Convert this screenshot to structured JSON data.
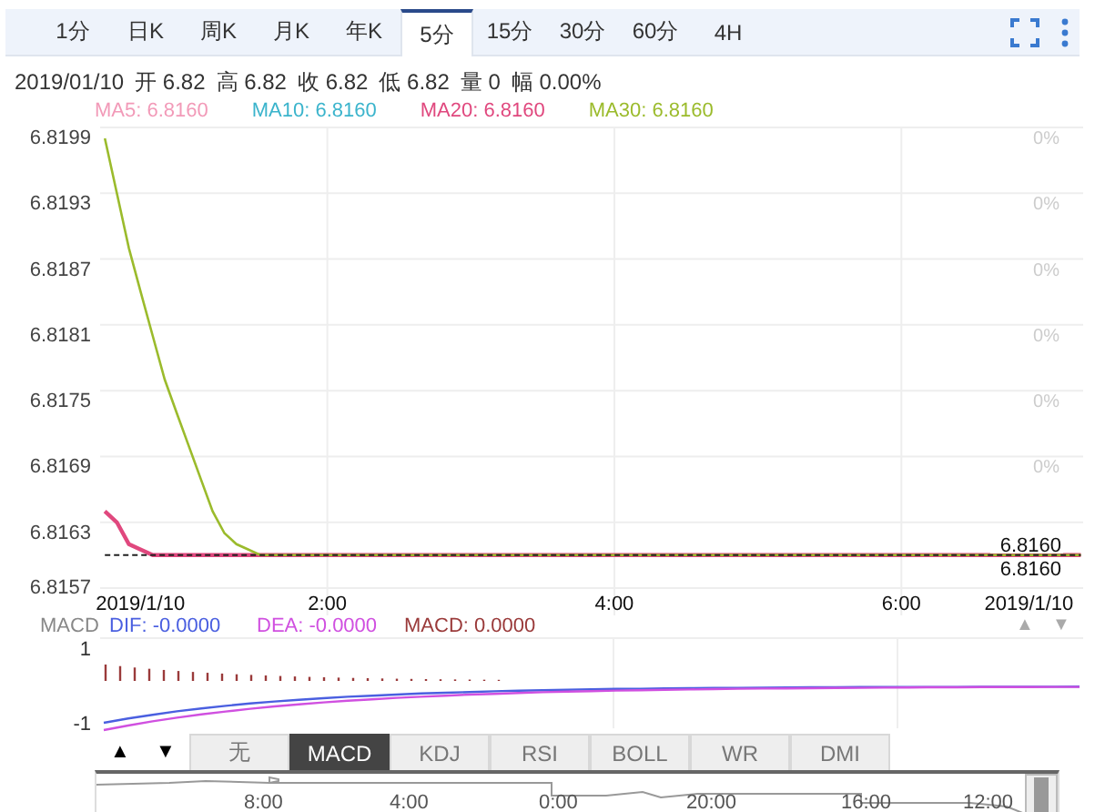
{
  "period_tabs": [
    {
      "label": "1分",
      "selected": false
    },
    {
      "label": "日K",
      "selected": false
    },
    {
      "label": "周K",
      "selected": false
    },
    {
      "label": "月K",
      "selected": false
    },
    {
      "label": "年K",
      "selected": false
    },
    {
      "label": "5分",
      "selected": true
    },
    {
      "label": "15分",
      "selected": false
    },
    {
      "label": "30分",
      "selected": false
    },
    {
      "label": "60分",
      "selected": false
    },
    {
      "label": "4H",
      "selected": false
    }
  ],
  "quote": {
    "date": "2019/01/10",
    "fields": [
      {
        "label": "开",
        "value": "6.82"
      },
      {
        "label": "高",
        "value": "6.82"
      },
      {
        "label": "收",
        "value": "6.82"
      },
      {
        "label": "低",
        "value": "6.82"
      },
      {
        "label": "量",
        "value": "0"
      },
      {
        "label": "幅",
        "value": "0.00%"
      }
    ]
  },
  "ma_legend": [
    {
      "label": "MA5: 6.8160",
      "color": "#f29ab8"
    },
    {
      "label": "MA10: 6.8160",
      "color": "#3bb4cc"
    },
    {
      "label": "MA20: 6.8160",
      "color": "#e0487e"
    },
    {
      "label": "MA30: 6.8160",
      "color": "#9bbb2c"
    }
  ],
  "price_chart": {
    "right_axis_labels": [
      "0%",
      "0%",
      "0%",
      "0%",
      "0%",
      "0%"
    ],
    "price_tags": [
      "6.8160",
      "6.8160"
    ],
    "chart_data": {
      "type": "line",
      "x": [
        27,
        32,
        37,
        42,
        47,
        52,
        57,
        62,
        67,
        72,
        77,
        82,
        87,
        92,
        97,
        435
      ],
      "grid": true,
      "series": [
        {
          "color": "#e0487e",
          "values": [
            6.8164,
            6.8163,
            6.8161,
            6.81605,
            6.816,
            6.816,
            6.816,
            6.816,
            6.816,
            6.816,
            6.816,
            6.816,
            6.816,
            6.816,
            6.816,
            6.816
          ]
        },
        {
          "color": "#9bbb2c",
          "values": [
            6.8198,
            6.8193,
            6.8188,
            6.8184,
            6.818,
            6.8176,
            6.8173,
            6.817,
            6.8167,
            6.8164,
            6.8162,
            6.8161,
            6.81605,
            6.816,
            6.816,
            6.816
          ]
        },
        {
          "color": "#222222",
          "line_style": "dashed",
          "values": [
            6.816,
            6.816,
            6.816,
            6.816,
            6.816,
            6.816,
            6.816,
            6.816,
            6.816,
            6.816,
            6.816,
            6.816,
            6.816,
            6.816,
            6.816,
            6.816
          ]
        }
      ],
      "xlim": [
        25,
        436
      ],
      "ylim": [
        6.8157,
        6.8199
      ],
      "xticks": [
        {
          "value": 27,
          "label": "2019/1/10"
        },
        {
          "value": 120,
          "label": "2:00"
        },
        {
          "value": 240,
          "label": "4:00"
        },
        {
          "value": 360,
          "label": "6:00"
        },
        {
          "value": 435,
          "label": "2019/1/10"
        }
      ],
      "yticks": [
        6.8199,
        6.8193,
        6.8187,
        6.8181,
        6.8175,
        6.8169,
        6.8163,
        6.8157
      ]
    }
  },
  "macd_legend": {
    "title": "MACD",
    "items": [
      {
        "label": "DIF: -0.0000",
        "color": "#4a5fe0"
      },
      {
        "label": "DEA: -0.0000",
        "color": "#d050e0"
      },
      {
        "label": "MACD: 0.0000",
        "color": "#9a3a3a"
      }
    ],
    "arrows": [
      "▲",
      "▼"
    ]
  },
  "macd_panel": {
    "axis_labels": [
      "1",
      "-1"
    ]
  },
  "indicator_controls": {
    "arrows": [
      "▲",
      "▼"
    ],
    "tabs": [
      {
        "label": "无",
        "selected": false
      },
      {
        "label": "MACD",
        "selected": true
      },
      {
        "label": "KDJ",
        "selected": false
      },
      {
        "label": "RSI",
        "selected": false
      },
      {
        "label": "BOLL",
        "selected": false
      },
      {
        "label": "WR",
        "selected": false
      },
      {
        "label": "DMI",
        "selected": false
      }
    ]
  },
  "navigator": {
    "labels": [
      "8:00",
      "4:00",
      "0:00",
      "20:00",
      "16:00",
      "12:00"
    ]
  }
}
